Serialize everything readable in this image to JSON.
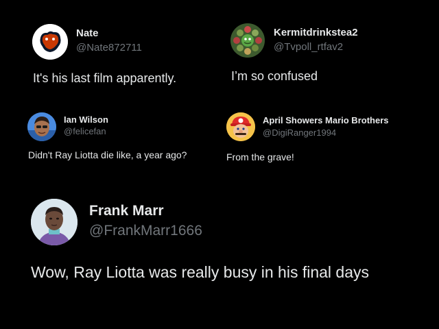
{
  "theme": {
    "background": "#000000",
    "text_primary": "#e7e9ea",
    "text_secondary": "#71767b"
  },
  "posts": [
    {
      "name": "Nate",
      "handle": "@Nate872711",
      "text": "It's his last film apparently.",
      "avatar_icon": "chicago-bears-logo-icon"
    },
    {
      "name": "Kermitdrinkstea2",
      "handle": "@Tvpoll_rtfav2",
      "text": "I’m so confused",
      "avatar_icon": "kermit-wreath-avatar-icon"
    },
    {
      "name": "Ian Wilson",
      "handle": "@felicefan",
      "text": "Didn't Ray Liotta die like, a year ago?",
      "avatar_icon": "person-face-avatar-icon"
    },
    {
      "name": "April Showers Mario Brothers",
      "handle": "@DigiRanger1994",
      "text": "From the grave!",
      "avatar_icon": "mario-avatar-icon"
    },
    {
      "name": "Frank Marr",
      "handle": "@FrankMarr1666",
      "text": "Wow, Ray Liotta was really busy in  his final days",
      "avatar_icon": "person-portrait-avatar-icon"
    }
  ]
}
